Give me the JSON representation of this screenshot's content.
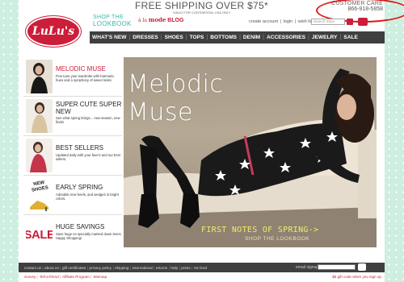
{
  "banner": {
    "shipping": "FREE SHIPPING OVER $75*",
    "shipping_note": "*VALID FOR CONTINENTAL USA ONLY"
  },
  "customer_care": {
    "label": "CUSTOMER CARE",
    "phone": "866-918-5858"
  },
  "logo": {
    "text": "LuLu's"
  },
  "header": {
    "shop_the": "SHOP THE",
    "lookbook": "LOOKBOOK",
    "blog_prefix": "à la",
    "blog_word": "mode",
    "blog_label": "BLOG",
    "util_links": [
      "create account",
      "login",
      "wish list"
    ],
    "search_placeholder": "Search Store"
  },
  "nav": {
    "items": [
      "WHAT'S NEW",
      "DRESSES",
      "SHOES",
      "TOPS",
      "BOTTOMS",
      "DENIM",
      "ACCESSORIES",
      "JEWELRY",
      "SALE"
    ]
  },
  "sidebar": {
    "promos": [
      {
        "title": "MELODIC MUSE",
        "desc": "Fine tune your wardrobe with harmonic hues and a symphony of sweet looks."
      },
      {
        "title": "SUPER CUTE SUPER NEW",
        "desc": "See what spring brings... new season, new finds!"
      },
      {
        "title": "BEST SELLERS",
        "desc": "Updated daily with your fave's and our best sellers."
      },
      {
        "title": "EARLY SPRING",
        "desc": "Adorable new heels, and wedges in bright colors."
      },
      {
        "title": "HUGE SAVINGS",
        "desc": "Save huge on specially marked down items. Happy Shopping!"
      }
    ],
    "badges": {
      "new_shoes": "NEW SHOES",
      "sale": "SALE"
    }
  },
  "hero": {
    "title": "Melodic Muse",
    "subtitle": "FIRST NOTES OF SPRING->",
    "cta": "SHOP THE LOOKBOOK"
  },
  "footer": {
    "links": [
      "contact us",
      "about us",
      "gift certificates",
      "privacy policy",
      "shipping",
      "international",
      "returns",
      "help",
      "press",
      "rss feed"
    ],
    "signup_label": "email signup",
    "sub_links": [
      "Survey",
      "Tell-a-friend",
      "Affiliate Program",
      "Sitemap"
    ],
    "gift_text": "$5 gift code when you sign up"
  },
  "colors": {
    "brand_red": "#cc1d3a",
    "nav_bg": "#3f3f3f",
    "teal": "#3bb6a8",
    "background_mint": "#cdeee0",
    "annotation_circle": "#e01818"
  }
}
